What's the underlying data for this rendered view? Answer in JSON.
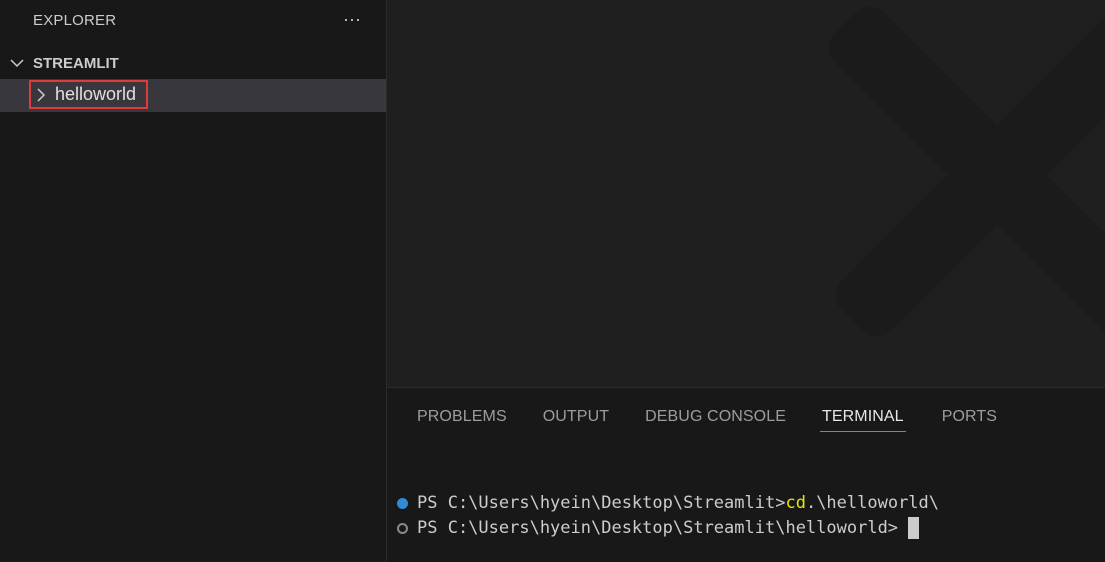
{
  "sidebar": {
    "header": "EXPLORER",
    "more_label": "···",
    "section_title": "STREAMLIT",
    "items": [
      {
        "label": "helloworld"
      }
    ]
  },
  "panel": {
    "tabs": [
      "PROBLEMS",
      "OUTPUT",
      "DEBUG CONSOLE",
      "TERMINAL",
      "PORTS"
    ],
    "active_tab": "TERMINAL",
    "terminal": {
      "line1_prompt": "PS C:\\Users\\hyein\\Desktop\\Streamlit>",
      "line1_cmd": "cd",
      "line1_args": ".\\helloworld\\",
      "line2_prompt": "PS C:\\Users\\hyein\\Desktop\\Streamlit\\helloworld>"
    }
  },
  "colors": {
    "highlight_border": "#e03a3a",
    "active_tab_underline": "#3794ff",
    "command_color": "#e5e510"
  }
}
